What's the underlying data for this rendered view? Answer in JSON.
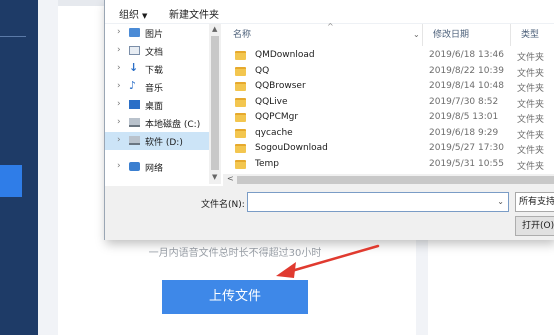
{
  "dialog": {
    "toolbar": {
      "organize": "组织",
      "new_folder": "新建文件夹"
    },
    "nav": [
      {
        "label": "图片",
        "icon": "pictures-icon",
        "selected": false
      },
      {
        "label": "文档",
        "icon": "documents-icon",
        "selected": false
      },
      {
        "label": "下载",
        "icon": "download-icon",
        "selected": false
      },
      {
        "label": "音乐",
        "icon": "music-icon",
        "selected": false
      },
      {
        "label": "桌面",
        "icon": "desktop-icon",
        "selected": false
      },
      {
        "label": "本地磁盘 (C:)",
        "icon": "disk-icon",
        "selected": false
      },
      {
        "label": "软件 (D:)",
        "icon": "disk-icon",
        "selected": true
      },
      {
        "label": "网络",
        "icon": "network-icon",
        "selected": false
      }
    ],
    "columns": {
      "name": "名称",
      "date": "修改日期",
      "type": "类型"
    },
    "files": [
      {
        "name": "QMDownload",
        "date": "2019/6/18 13:46",
        "type": "文件夹"
      },
      {
        "name": "QQ",
        "date": "2019/8/22 10:39",
        "type": "文件夹"
      },
      {
        "name": "QQBrowser",
        "date": "2019/8/14 10:48",
        "type": "文件夹"
      },
      {
        "name": "QQLive",
        "date": "2019/7/30 8:52",
        "type": "文件夹"
      },
      {
        "name": "QQPCMgr",
        "date": "2019/8/5 13:01",
        "type": "文件夹"
      },
      {
        "name": "qycache",
        "date": "2019/6/18 9:29",
        "type": "文件夹"
      },
      {
        "name": "SogouDownload",
        "date": "2019/5/27 17:30",
        "type": "文件夹"
      },
      {
        "name": "Temp",
        "date": "2019/5/31 10:55",
        "type": "文件夹"
      }
    ],
    "filename_label": "文件名(N):",
    "filename_value": "",
    "filter_label": "所有支持",
    "open_label": "打开(O)"
  },
  "page": {
    "hint": "一月内语音文件总时长不得超过30小时",
    "upload_button": "上传文件"
  },
  "colors": {
    "accent": "#3e88e8",
    "nav_bg": "#1e3b67",
    "folder": "#f3c64f",
    "arrow": "#e03a2f",
    "selection": "#cce4f7"
  }
}
